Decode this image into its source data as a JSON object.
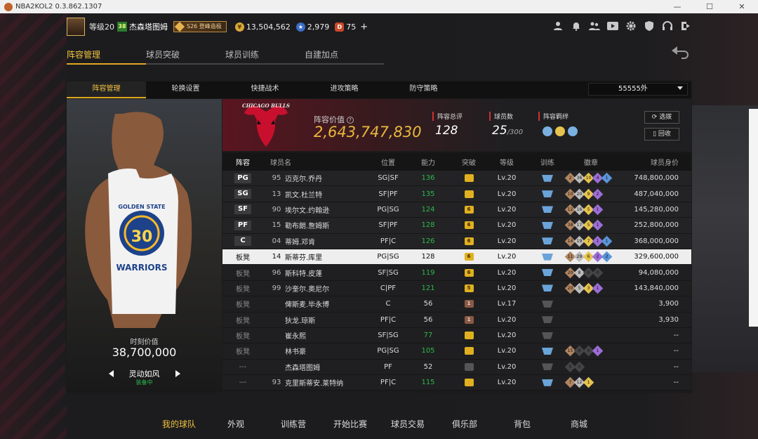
{
  "window": {
    "title": "NBA2KOL2 0.3.862.1307",
    "min": "—",
    "max": "☐",
    "close": "✕"
  },
  "header": {
    "level": "等级20",
    "team_badge": "38",
    "player_name": "杰森塔图姆",
    "season_badge": "S26 登峰造极",
    "gold": "13,504,562",
    "points": "2,979",
    "d_coins": "75",
    "add": "+",
    "gold_icon": "¥",
    "star_icon": "★",
    "d_icon": "D",
    "icons": [
      "user-icon",
      "bell-icon",
      "friends-icon",
      "video-icon",
      "gear-icon",
      "shield-icon",
      "headset-icon",
      "exit-icon"
    ]
  },
  "main_tabs": [
    "阵容管理",
    "球员突破",
    "球员训练",
    "自建加点"
  ],
  "sub_tabs": [
    "阵容管理",
    "轮换设置",
    "快捷战术",
    "进攻策略",
    "防守策略"
  ],
  "lineup_select": "55555外",
  "player_card": {
    "jersey_text": "GOLDEN STATE",
    "jersey_number": "30",
    "jersey_team": "WARRIORS",
    "market_label": "时刻价值",
    "market_value": "38,700,000",
    "skill_name": "灵动如风",
    "skill_status": "装备中"
  },
  "team": {
    "logo_text": "CHICAGO BULLS",
    "value_label": "阵容价值",
    "value": "2,643,747,830",
    "rating_label": "阵容总评",
    "rating": "128",
    "count_label": "球员数",
    "count": "25",
    "count_max": "/300",
    "bond_label": "阵容羁绊",
    "btn_select": "选拨",
    "btn_recycle": "回收"
  },
  "table": {
    "headers": {
      "lineup": "阵容",
      "name": "球员名",
      "position": "位置",
      "ability": "能力",
      "breakthrough": "突破",
      "level": "等级",
      "training": "训练",
      "badges": "徽章",
      "value": "球员身价"
    },
    "rows": [
      {
        "slot": "PG",
        "num": "95",
        "name": "迈克尔.乔丹",
        "pos": "SG|SF",
        "ab": "136",
        "br": "",
        "lv": "Lv.20",
        "val": "748,800,000",
        "badges": [
          "2",
          "36",
          "10",
          "4",
          "1"
        ]
      },
      {
        "slot": "SG",
        "num": "13",
        "name": "凯文.杜兰特",
        "pos": "SF|PF",
        "ab": "135",
        "br": "",
        "lv": "Lv.20",
        "val": "487,040,000",
        "badges": [
          "10",
          "20",
          "9",
          "2"
        ]
      },
      {
        "slot": "SF",
        "num": "90",
        "name": "埃尔文.约翰逊",
        "pos": "PG|SG",
        "ab": "124",
        "br": "6",
        "lv": "Lv.20",
        "val": "145,280,000",
        "badges": [
          "12",
          "16",
          "5",
          "1"
        ]
      },
      {
        "slot": "PF",
        "num": "15",
        "name": "勒布朗.詹姆斯",
        "pos": "SF|PF",
        "ab": "128",
        "br": "6",
        "lv": "Lv.20",
        "val": "252,800,000",
        "badges": [
          "38",
          "17",
          "5",
          "1"
        ]
      },
      {
        "slot": "C",
        "num": "04",
        "name": "蒂姆.邓肯",
        "pos": "PF|C",
        "ab": "126",
        "br": "6",
        "lv": "Lv.20",
        "val": "368,000,000",
        "badges": [
          "14",
          "19",
          "7",
          "1",
          "1"
        ]
      },
      {
        "slot": "板凳",
        "num": "14",
        "name": "斯蒂芬.库里",
        "pos": "PG|SG",
        "ab": "128",
        "br": "6",
        "lv": "Lv.20",
        "val": "329,600,000",
        "badges": [
          "11",
          "29",
          "6",
          "2",
          "2"
        ]
      },
      {
        "slot": "板凳",
        "num": "96",
        "name": "斯科特.皮蓬",
        "pos": "SF|SG",
        "ab": "119",
        "br": "6",
        "lv": "Lv.20",
        "val": "94,080,000",
        "badges": [
          "20",
          "8",
          "0",
          "0"
        ]
      },
      {
        "slot": "板凳",
        "num": "99",
        "name": "沙奎尔.奥尼尔",
        "pos": "C|PF",
        "ab": "121",
        "br": "5",
        "lv": "Lv.20",
        "val": "143,840,000",
        "badges": [
          "20",
          "5",
          "3",
          "1"
        ]
      },
      {
        "slot": "板凳",
        "num": "",
        "name": "俾斯麦.毕永博",
        "pos": "C",
        "ab": "56",
        "br": "1",
        "lv": "Lv.17",
        "val": "3,900",
        "badges": []
      },
      {
        "slot": "板凳",
        "num": "",
        "name": "狄龙.琼斯",
        "pos": "PF|C",
        "ab": "56",
        "br": "1",
        "lv": "Lv.20",
        "val": "3,930",
        "badges": []
      },
      {
        "slot": "板凳",
        "num": "",
        "name": "崔永熙",
        "pos": "SF|SG",
        "ab": "77",
        "br": "",
        "lv": "Lv.20",
        "val": "--",
        "badges": []
      },
      {
        "slot": "板凳",
        "num": "",
        "name": "林书豪",
        "pos": "PG|SG",
        "ab": "105",
        "br": "",
        "lv": "Lv.20",
        "val": "--",
        "badges": [
          "15",
          "0",
          "0",
          "1"
        ]
      },
      {
        "slot": "---",
        "num": "",
        "name": "杰森塔图姆",
        "pos": "PF",
        "ab": "52",
        "br": "",
        "lv": "Lv.20",
        "val": "--",
        "badges": [
          "0",
          "0"
        ]
      },
      {
        "slot": "---",
        "num": "93",
        "name": "克里斯蒂安.莱特纳",
        "pos": "PF|C",
        "ab": "115",
        "br": "",
        "lv": "Lv.20",
        "val": "--",
        "badges": [
          "7",
          "12",
          "1"
        ]
      }
    ]
  },
  "bottom_nav": [
    "我的球队",
    "外观",
    "训练营",
    "开始比赛",
    "球员交易",
    "俱乐部",
    "背包",
    "商城"
  ],
  "colors": {
    "accent": "#e0a820",
    "ability_green": "#2db84a",
    "bulls_red": "#c8102e"
  }
}
